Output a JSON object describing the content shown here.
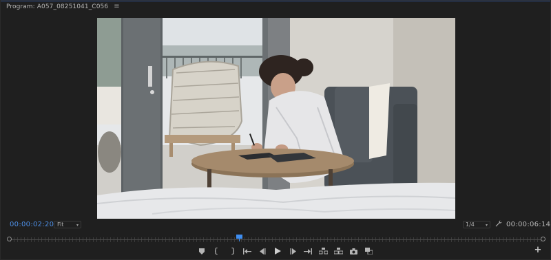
{
  "panel": {
    "title": "Program: A057_08251041_C056",
    "menu_icon": "hamburger-icon"
  },
  "viewer": {
    "scene": "woman writing at a round table by a balcony window"
  },
  "controls": {
    "current_timecode": "00:00:02:20",
    "fit_label": "Fit",
    "resolution_label": "1/4",
    "duration_timecode": "00:00:06:14",
    "settings_icon": "wrench-icon"
  },
  "scrubber": {
    "playhead_fraction": 0.43
  },
  "transport": {
    "buttons": [
      {
        "name": "add-marker-button",
        "icon": "marker-icon"
      },
      {
        "name": "mark-in-button",
        "icon": "mark-in-icon"
      },
      {
        "name": "mark-out-button",
        "icon": "mark-out-icon"
      },
      {
        "name": "go-to-in-button",
        "icon": "go-to-in-icon"
      },
      {
        "name": "step-back-button",
        "icon": "step-back-icon"
      },
      {
        "name": "play-button",
        "icon": "play-icon"
      },
      {
        "name": "step-forward-button",
        "icon": "step-forward-icon"
      },
      {
        "name": "go-to-out-button",
        "icon": "go-to-out-icon"
      },
      {
        "name": "lift-button",
        "icon": "lift-icon"
      },
      {
        "name": "extract-button",
        "icon": "extract-icon"
      },
      {
        "name": "export-frame-button",
        "icon": "camera-icon"
      },
      {
        "name": "comparison-view-button",
        "icon": "comparison-icon"
      }
    ],
    "add_icon": "plus-icon",
    "add_glyph": "+"
  },
  "colors": {
    "accent": "#3f8ef0",
    "timecode_blue": "#4d8fe6",
    "panel_bg": "#1f1f1f"
  }
}
